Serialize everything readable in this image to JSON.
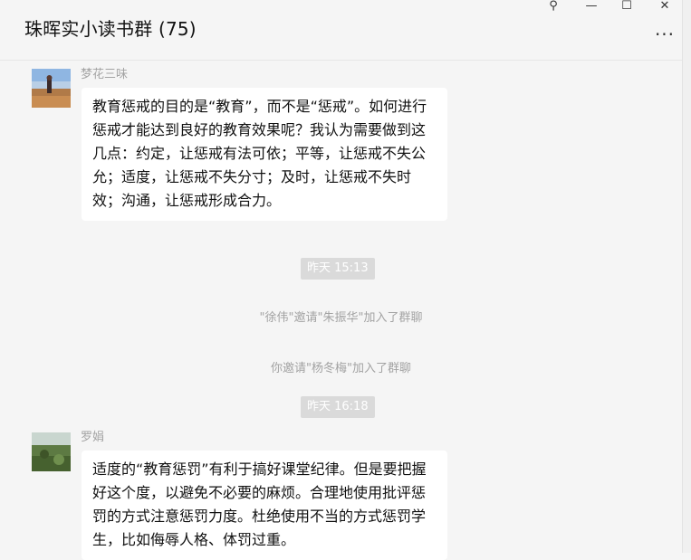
{
  "window": {
    "title": "珠晖实小读书群 (75)",
    "controls": {
      "pin": "⚲",
      "minimize": "—",
      "maximize": "☐",
      "close": "✕"
    },
    "more": "···"
  },
  "messages": [
    {
      "sender": "梦花三味",
      "text": "教育惩戒的目的是“教育”，而不是“惩戒”。如何进行惩戒才能达到良好的教育效果呢？我认为需要做到这几点：约定，让惩戒有法可依；平等，让惩戒不失公允；适度，让惩戒不失分寸；及时，让惩戒不失时效；沟通，让惩戒形成合力。"
    },
    {
      "sender": "罗娟",
      "text": "适度的“教育惩罚”有利于搞好课堂纪律。但是要把握好这个度，以避免不必要的麻烦。合理地使用批评惩罚的方式注意惩罚力度。杜绝使用不当的方式惩罚学生，比如侮辱人格、体罚过重。"
    }
  ],
  "timestamps": [
    "昨天 15:13",
    "昨天 16:18"
  ],
  "system_notices": [
    "\"徐伟\"邀请\"朱振华\"加入了群聊",
    "你邀请\"杨冬梅\"加入了群聊"
  ]
}
